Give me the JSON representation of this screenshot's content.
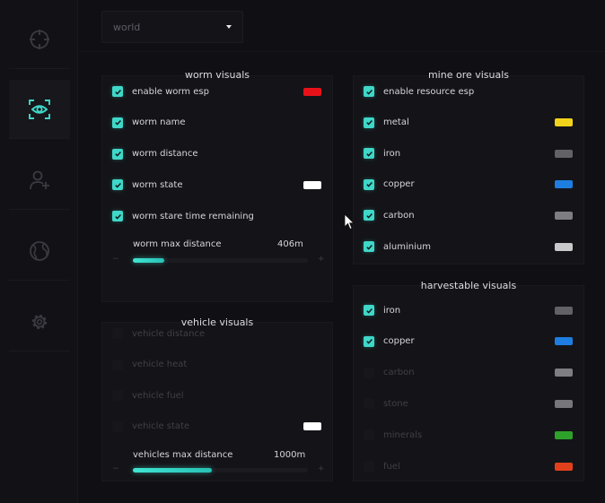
{
  "sidebar": {
    "items": [
      {
        "name": "crosshair",
        "active": false
      },
      {
        "name": "eye",
        "active": true
      },
      {
        "name": "user-add",
        "active": false
      },
      {
        "name": "globe",
        "active": false
      },
      {
        "name": "gear",
        "active": false
      }
    ]
  },
  "world_select": {
    "value": "world"
  },
  "worm": {
    "title": "worm visuals",
    "items": [
      {
        "label": "enable worm esp",
        "checked": true,
        "color": "#e8111a"
      },
      {
        "label": "worm name",
        "checked": true,
        "color": null
      },
      {
        "label": "worm distance",
        "checked": true,
        "color": null
      },
      {
        "label": "worm state",
        "checked": true,
        "color": "#ffffff"
      },
      {
        "label": "worm stare time remaining",
        "checked": true,
        "color": null
      }
    ],
    "slider": {
      "label": "worm max distance",
      "value": "406m",
      "fraction": 0.18,
      "minus": "−",
      "plus": "+"
    }
  },
  "vehicle": {
    "title": "vehicle visuals",
    "items": [
      {
        "label": "vehicle distance",
        "checked": false,
        "color": null
      },
      {
        "label": "vehicle heat",
        "checked": false,
        "color": null
      },
      {
        "label": "vehicle fuel",
        "checked": false,
        "color": null
      },
      {
        "label": "vehicle state",
        "checked": false,
        "color": "#ffffff"
      }
    ],
    "slider": {
      "label": "vehicles max distance",
      "value": "1000m",
      "fraction": 0.45,
      "minus": "−",
      "plus": "+"
    }
  },
  "mine": {
    "title": "mine ore visuals",
    "items": [
      {
        "label": "enable resource esp",
        "checked": true,
        "color": null
      },
      {
        "label": "metal",
        "checked": true,
        "color": "#f2d31b"
      },
      {
        "label": "iron",
        "checked": true,
        "color": "#626266"
      },
      {
        "label": "copper",
        "checked": true,
        "color": "#1e7de0"
      },
      {
        "label": "carbon",
        "checked": true,
        "color": "#7e7e82"
      },
      {
        "label": "aluminium",
        "checked": true,
        "color": "#c9c9cc"
      }
    ]
  },
  "harvest": {
    "title": "harvestable visuals",
    "items": [
      {
        "label": "iron",
        "checked": true,
        "color": "#626266"
      },
      {
        "label": "copper",
        "checked": true,
        "color": "#1e7de0"
      },
      {
        "label": "carbon",
        "checked": false,
        "color": "#7e7e82"
      },
      {
        "label": "stone",
        "checked": false,
        "color": "#77777b"
      },
      {
        "label": "minerals",
        "checked": false,
        "color": "#2ea12a"
      },
      {
        "label": "fuel",
        "checked": false,
        "color": "#e2401c"
      }
    ]
  }
}
